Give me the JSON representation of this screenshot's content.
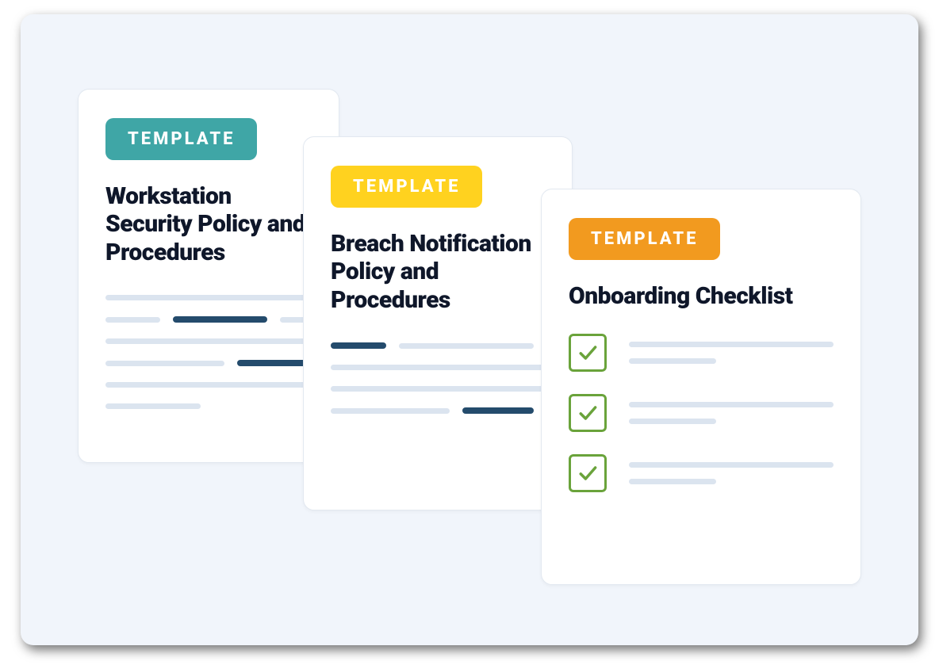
{
  "badge_label": "TEMPLATE",
  "colors": {
    "panel_bg": "#f1f5fb",
    "card_border": "#e2e8f0",
    "badge_teal": "#3fa6a6",
    "badge_yellow": "#ffd21f",
    "badge_orange": "#f29a1f",
    "line_light": "#dbe4ef",
    "line_dark": "#244b6c",
    "check_green": "#6aa33b",
    "title_color": "#0f172a"
  },
  "cards": [
    {
      "title": "Workstation Security Policy and Procedures"
    },
    {
      "title": "Breach Notification Policy and Procedures"
    },
    {
      "title": "Onboarding Checklist"
    }
  ]
}
